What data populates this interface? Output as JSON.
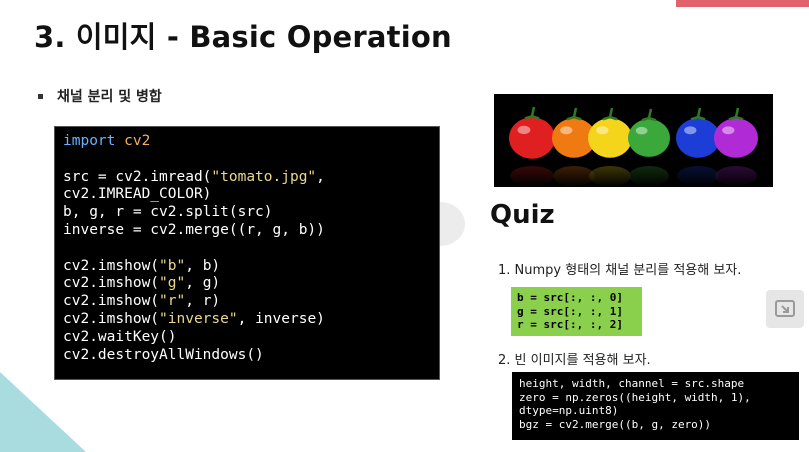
{
  "slide": {
    "title": "3. 이미지 - Basic Operation",
    "section_label": "채널 분리 및 병합",
    "main_code": {
      "line1_keyword": "import",
      "line1_module": "cv2",
      "line3_prefix": "src = cv2.imread(",
      "line3_string": "\"tomato.jpg\"",
      "line3_suffix": ",",
      "line4": "cv2.IMREAD_COLOR)",
      "line5": "b, g, r = cv2.split(src)",
      "line6": "inverse = cv2.merge((r, g, b))",
      "show_lines": [
        {
          "prefix": "cv2.imshow(",
          "string": "\"b\"",
          "suffix": ", b)"
        },
        {
          "prefix": "cv2.imshow(",
          "string": "\"g\"",
          "suffix": ", g)"
        },
        {
          "prefix": "cv2.imshow(",
          "string": "\"r\"",
          "suffix": ", r)"
        },
        {
          "prefix": "cv2.imshow(",
          "string": "\"inverse\"",
          "suffix": ", inverse)"
        }
      ],
      "line12": "cv2.waitKey()",
      "line13": "cv2.destroyAllWindows()"
    },
    "image": {
      "description_icon": "tomato-row-image",
      "tomato_colors": [
        "#e02020",
        "#f07a12",
        "#f5d51c",
        "#3aa83a",
        "#1c3ed6",
        "#b02ad6"
      ]
    },
    "quiz": {
      "title": "Quiz",
      "q1": "1. Numpy 형태의 채널 분리를 적용해 보자.",
      "q1_code": [
        "b = src[:, :, 0]",
        "g = src[:, :, 1]",
        "r = src[:, :, 2]"
      ],
      "q2": "2. 빈 이미지를 적용해 보자.",
      "q2_code": [
        "height, width, channel = src.shape",
        "zero = np.zeros((height, width, 1),",
        "dtype=np.uint8)",
        "bgz = cv2.merge((b, g, zero))"
      ]
    },
    "colors": {
      "accent": "#e0626c",
      "corner": "#a9dcdf",
      "quiz_code_bg": "#8bd04c"
    }
  }
}
